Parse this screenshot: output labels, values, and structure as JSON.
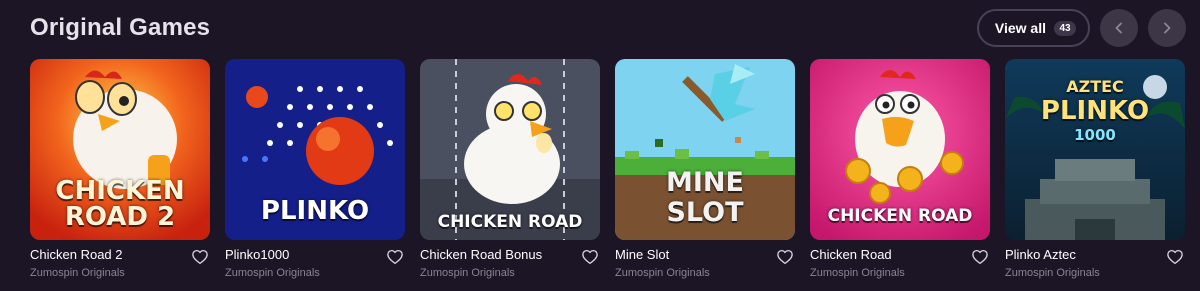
{
  "section": {
    "title": "Original Games",
    "view_all_label": "View all",
    "view_all_count": "43"
  },
  "games": [
    {
      "name": "Chicken Road 2",
      "provider": "Zumospin Originals",
      "logo_lines": [
        "CHICKEN",
        "ROAD 2"
      ]
    },
    {
      "name": "Plinko1000",
      "provider": "Zumospin Originals",
      "logo_lines": [
        "PLINKO"
      ]
    },
    {
      "name": "Chicken Road Bonus",
      "provider": "Zumospin Originals",
      "logo_lines": [
        "CHICKEN ROAD"
      ]
    },
    {
      "name": "Mine Slot",
      "provider": "Zumospin Originals",
      "logo_lines": [
        "MINE",
        "SLOT"
      ]
    },
    {
      "name": "Chicken Road",
      "provider": "Zumospin Originals",
      "logo_lines": [
        "CHICKEN ROAD"
      ]
    },
    {
      "name": "Plinko Aztec",
      "provider": "Zumospin Originals",
      "logo_lines": [
        "AZTEC",
        "PLINKO",
        "1000"
      ]
    }
  ],
  "icons": {
    "prev": "chevron-left-icon",
    "next": "chevron-right-icon",
    "favorite": "heart-outline-icon"
  },
  "colors": {
    "background": "#1c1526",
    "nav_button": "#3d3647",
    "muted_text": "#8b8494"
  }
}
